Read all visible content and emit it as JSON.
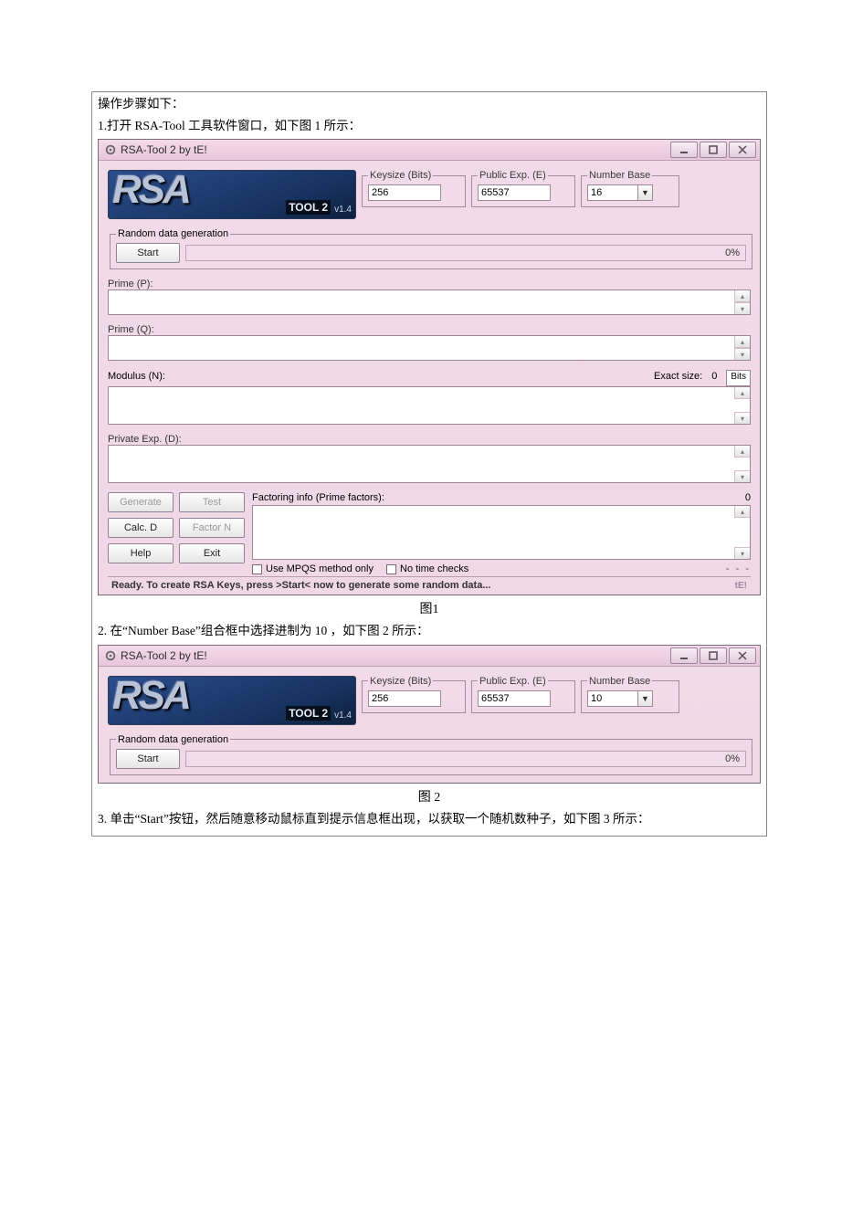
{
  "doc": {
    "intro": "操作步骤如下：",
    "step1": "1.打开 RSA-Tool  工具软件窗口，如下图 1 所示：",
    "fig1_caption": "图1",
    "step2": "2.  在“Number Base”组合框中选择进制为  10 ，如下图 2 所示：",
    "fig2_caption": "图 2",
    "step3": "3.  单击“Start”按钮，然后随意移动鼠标直到提示信息框出现，以获取一个随机数种子，如下图 3 所示："
  },
  "win_common": {
    "title": "RSA-Tool 2 by tE!",
    "logo_tool": "TOOL 2",
    "logo_ver": "v1.4",
    "keysize_legend": "Keysize (Bits)",
    "publicexp_legend": "Public Exp. (E)",
    "numbase_legend": "Number Base",
    "rdg_legend": "Random data generation",
    "start_btn": "Start",
    "progress_text": "0%",
    "keysize_val": "256",
    "publicexp_val": "65537"
  },
  "win1": {
    "numbase_val": "16",
    "primeP_label": "Prime (P):",
    "primeQ_label": "Prime (Q):",
    "modulus_label": "Modulus (N):",
    "exact_size_label": "Exact size:",
    "exact_size_val": "0",
    "bits_label": "Bits",
    "privexp_label": "Private Exp. (D):",
    "btn_generate": "Generate",
    "btn_test": "Test",
    "btn_calcd": "Calc. D",
    "btn_factorn": "Factor N",
    "btn_help": "Help",
    "btn_exit": "Exit",
    "factor_label": "Factoring info (Prime factors):",
    "factor_count": "0",
    "chk_mpqs": "Use MPQS method only",
    "chk_notime": "No time checks",
    "dots": "- - -",
    "status": "Ready. To create RSA Keys, press >Start< now to generate some random data...",
    "grip": "tE!"
  },
  "win2": {
    "numbase_val": "10"
  }
}
